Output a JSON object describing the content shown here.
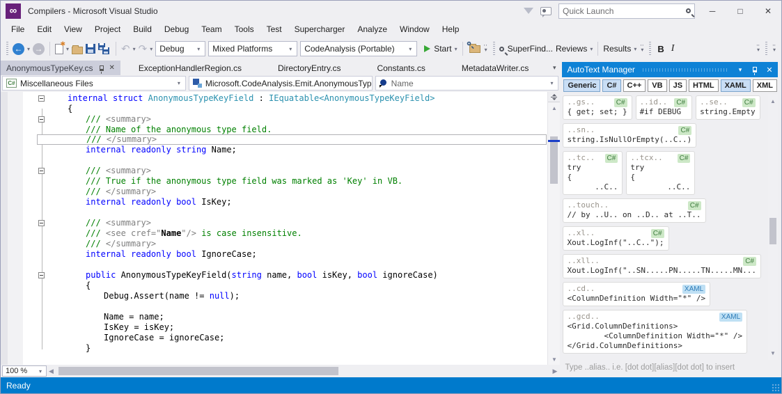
{
  "window": {
    "title": "Compilers - Microsoft Visual Studio"
  },
  "title_bar": {
    "quick_launch_placeholder": "Quick Launch"
  },
  "menu": {
    "items": [
      "File",
      "Edit",
      "View",
      "Project",
      "Build",
      "Debug",
      "Team",
      "Tools",
      "Test",
      "Supercharger",
      "Analyze",
      "Window",
      "Help"
    ]
  },
  "toolbar": {
    "debug_combo": "Debug",
    "platform_combo": "Mixed Platforms",
    "config_combo": "CodeAnalysis (Portable)",
    "start_label": "Start",
    "superfind_label": "SuperFind...",
    "reviews_label": "Reviews",
    "results_label": "Results",
    "bold_label": "B",
    "italic_label": "I"
  },
  "tabs": {
    "items": [
      {
        "label": "AnonymousTypeKey.cs",
        "active": true
      },
      {
        "label": "ExceptionHandlerRegion.cs",
        "active": false
      },
      {
        "label": "DirectoryEntry.cs",
        "active": false
      },
      {
        "label": "Constants.cs",
        "active": false
      },
      {
        "label": "MetadataWriter.cs",
        "active": false
      }
    ]
  },
  "navbar": {
    "project": "Miscellaneous Files",
    "type": "Microsoft.CodeAnalysis.Emit.AnonymousTyp",
    "member": "Name"
  },
  "editor": {
    "zoom": "100 %",
    "code_lines": [
      {
        "indent": 1,
        "outline": true,
        "current": false,
        "segments": [
          [
            "k",
            "internal"
          ],
          [
            "n",
            " "
          ],
          [
            "k",
            "struct"
          ],
          [
            "n",
            " "
          ],
          [
            "t",
            "AnonymousTypeKeyField"
          ],
          [
            "n",
            " : "
          ],
          [
            "t",
            "IEquatable<AnonymousTypeKeyField>"
          ]
        ]
      },
      {
        "indent": 1,
        "outline": false,
        "current": false,
        "segments": [
          [
            "n",
            "{"
          ]
        ]
      },
      {
        "indent": 2,
        "outline": true,
        "current": false,
        "segments": [
          [
            "c",
            "/// "
          ],
          [
            "g",
            "<summary>"
          ]
        ]
      },
      {
        "indent": 2,
        "outline": false,
        "current": false,
        "segments": [
          [
            "c",
            "/// Name of the anonymous type field."
          ]
        ]
      },
      {
        "indent": 2,
        "outline": false,
        "current": true,
        "segments": [
          [
            "c",
            "/// "
          ],
          [
            "g",
            "</summary>"
          ]
        ]
      },
      {
        "indent": 2,
        "outline": false,
        "current": false,
        "segments": [
          [
            "k",
            "internal"
          ],
          [
            "n",
            " "
          ],
          [
            "k",
            "readonly"
          ],
          [
            "n",
            " "
          ],
          [
            "k",
            "string"
          ],
          [
            "n",
            " Name;"
          ]
        ]
      },
      {
        "indent": 0,
        "outline": false,
        "current": false,
        "segments": []
      },
      {
        "indent": 2,
        "outline": true,
        "current": false,
        "segments": [
          [
            "c",
            "/// "
          ],
          [
            "g",
            "<summary>"
          ]
        ]
      },
      {
        "indent": 2,
        "outline": false,
        "current": false,
        "segments": [
          [
            "c",
            "/// True if the anonymous type field was marked as 'Key' in VB."
          ]
        ]
      },
      {
        "indent": 2,
        "outline": false,
        "current": false,
        "segments": [
          [
            "c",
            "/// "
          ],
          [
            "g",
            "</summary>"
          ]
        ]
      },
      {
        "indent": 2,
        "outline": false,
        "current": false,
        "segments": [
          [
            "k",
            "internal"
          ],
          [
            "n",
            " "
          ],
          [
            "k",
            "readonly"
          ],
          [
            "n",
            " "
          ],
          [
            "k",
            "bool"
          ],
          [
            "n",
            " IsKey;"
          ]
        ]
      },
      {
        "indent": 0,
        "outline": false,
        "current": false,
        "segments": []
      },
      {
        "indent": 2,
        "outline": true,
        "current": false,
        "segments": [
          [
            "c",
            "/// "
          ],
          [
            "g",
            "<summary>"
          ]
        ]
      },
      {
        "indent": 2,
        "outline": false,
        "current": false,
        "segments": [
          [
            "c",
            "/// "
          ],
          [
            "g",
            "<see cref=\""
          ],
          [
            "b",
            "Name"
          ],
          [
            "g",
            "\"/>"
          ],
          [
            "c",
            " is case insensitive."
          ]
        ]
      },
      {
        "indent": 2,
        "outline": false,
        "current": false,
        "segments": [
          [
            "c",
            "/// "
          ],
          [
            "g",
            "</summary>"
          ]
        ]
      },
      {
        "indent": 2,
        "outline": false,
        "current": false,
        "segments": [
          [
            "k",
            "internal"
          ],
          [
            "n",
            " "
          ],
          [
            "k",
            "readonly"
          ],
          [
            "n",
            " "
          ],
          [
            "k",
            "bool"
          ],
          [
            "n",
            " IgnoreCase;"
          ]
        ]
      },
      {
        "indent": 0,
        "outline": false,
        "current": false,
        "segments": []
      },
      {
        "indent": 2,
        "outline": true,
        "current": false,
        "segments": [
          [
            "k",
            "public"
          ],
          [
            "n",
            " AnonymousTypeKeyField("
          ],
          [
            "k",
            "string"
          ],
          [
            "n",
            " name, "
          ],
          [
            "k",
            "bool"
          ],
          [
            "n",
            " isKey, "
          ],
          [
            "k",
            "bool"
          ],
          [
            "n",
            " ignoreCase)"
          ]
        ]
      },
      {
        "indent": 2,
        "outline": false,
        "current": false,
        "segments": [
          [
            "n",
            "{"
          ]
        ]
      },
      {
        "indent": 3,
        "outline": false,
        "current": false,
        "segments": [
          [
            "n",
            "Debug.Assert(name != "
          ],
          [
            "k",
            "null"
          ],
          [
            "n",
            ");"
          ]
        ]
      },
      {
        "indent": 0,
        "outline": false,
        "current": false,
        "segments": []
      },
      {
        "indent": 3,
        "outline": false,
        "current": false,
        "segments": [
          [
            "n",
            "Name = name;"
          ]
        ]
      },
      {
        "indent": 3,
        "outline": false,
        "current": false,
        "segments": [
          [
            "n",
            "IsKey = isKey;"
          ]
        ]
      },
      {
        "indent": 3,
        "outline": false,
        "current": false,
        "segments": [
          [
            "n",
            "IgnoreCase = ignoreCase;"
          ]
        ]
      },
      {
        "indent": 2,
        "outline": false,
        "current": false,
        "segments": [
          [
            "n",
            "}"
          ]
        ]
      }
    ]
  },
  "panel": {
    "title": "AutoText Manager",
    "tabs": [
      {
        "label": "Generic",
        "selected": true
      },
      {
        "label": "C#",
        "selected": true
      },
      {
        "label": "C++",
        "selected": false
      },
      {
        "label": "VB",
        "selected": false
      },
      {
        "label": "JS",
        "selected": false
      },
      {
        "label": "HTML",
        "selected": false
      },
      {
        "label": "XAML",
        "selected": true
      },
      {
        "label": "XML",
        "selected": false
      }
    ],
    "snippet_rows": [
      [
        {
          "alias": "..gs..",
          "lang": "C#",
          "body": [
            "{ get; set; }"
          ]
        },
        {
          "alias": "..id..",
          "lang": "C#",
          "body": [
            "#if DEBUG"
          ]
        },
        {
          "alias": "..se..",
          "lang": "C#",
          "body": [
            "string.Empty"
          ]
        }
      ],
      [
        {
          "alias": "..sn..",
          "lang": "C#",
          "body": [
            "string.IsNullOrEmpty(..C..)"
          ]
        }
      ],
      [
        {
          "alias": "..tc..",
          "lang": "C#",
          "body": [
            "try",
            "{",
            "      ..C.."
          ]
        },
        {
          "alias": "..tcx..",
          "lang": "C#",
          "body": [
            "try",
            "{",
            "        ..C.."
          ]
        }
      ],
      [
        {
          "alias": "..touch..",
          "lang": "C#",
          "body": [
            "// by ..U.. on ..D.. at ..T.."
          ]
        }
      ],
      [
        {
          "alias": "..xl..",
          "lang": "C#",
          "body": [
            "Xout.LogInf(\"..C..\");"
          ]
        }
      ],
      [
        {
          "alias": "..xll..",
          "lang": "C#",
          "body": [
            "Xout.LogInf(\"..SN.....PN.....TN.....MN..."
          ]
        }
      ],
      [
        {
          "alias": "..cd..",
          "lang": "XAML",
          "body": [
            "<ColumnDefinition Width=\"*\" />"
          ]
        }
      ],
      [
        {
          "alias": "..gcd..",
          "lang": "XAML",
          "body": [
            "<Grid.ColumnDefinitions>",
            "        <ColumnDefinition Width=\"*\" />",
            "</Grid.ColumnDefinitions>"
          ]
        }
      ]
    ],
    "hint": "Type ..alias.. i.e. [dot dot][alias][dot dot] to insert"
  },
  "status_bar": {
    "text": "Ready"
  },
  "colors": {
    "status_blue": "#007ACC",
    "panel_title_blue": "#0E82D6",
    "logo_purple": "#68217A",
    "keyword_blue": "#0000FF",
    "type_teal": "#2B91AF",
    "comment_green": "#008000",
    "doc_tag_gray": "#808080",
    "active_tab_gray": "#CCCEDB",
    "badge_cs_green": "#CDE8C7",
    "badge_xaml_blue": "#BFE0F4"
  }
}
